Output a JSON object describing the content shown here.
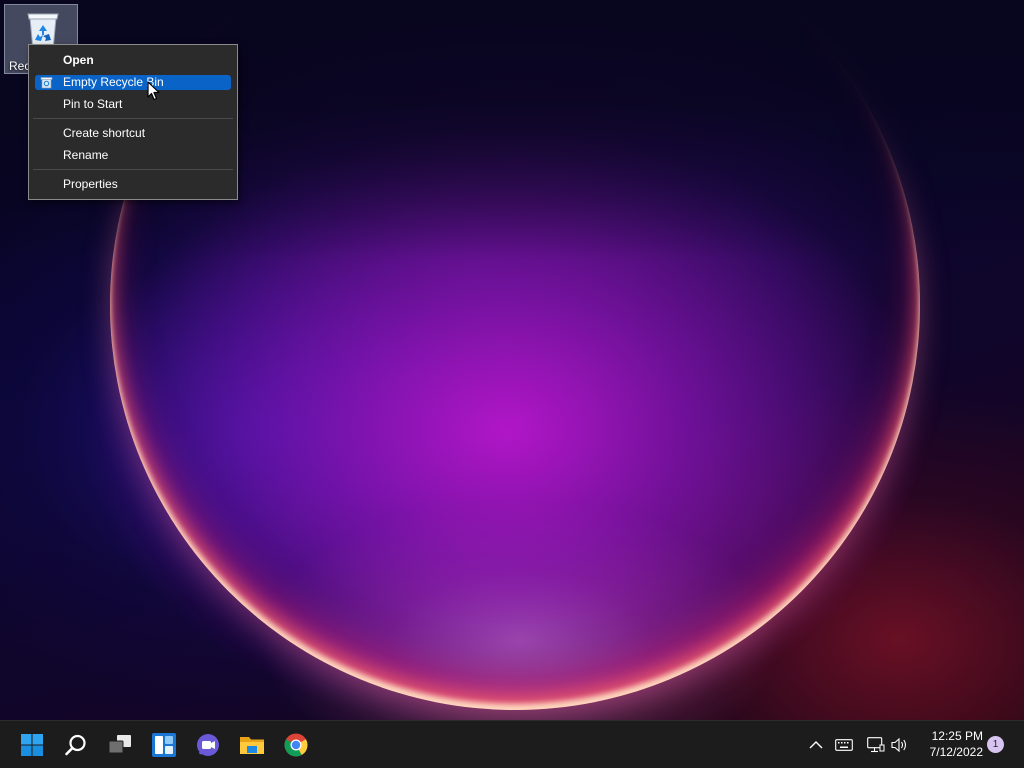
{
  "desktop": {
    "icons": [
      {
        "label": "Rec",
        "icon": "recycle-bin-icon"
      }
    ]
  },
  "context_menu": {
    "items": [
      {
        "label": "Open",
        "bold": true
      },
      {
        "label": "Empty Recycle Bin",
        "highlighted": true,
        "icon": "recycle-bin-small-icon"
      },
      {
        "label": "Pin to Start"
      },
      {
        "label": "Create shortcut"
      },
      {
        "label": "Rename"
      },
      {
        "label": "Properties"
      }
    ],
    "highlight_color": "#0a64c8"
  },
  "taskbar": {
    "apps": [
      {
        "name": "start",
        "icon": "windows-logo-icon"
      },
      {
        "name": "search",
        "icon": "search-icon"
      },
      {
        "name": "task-view",
        "icon": "task-view-icon"
      },
      {
        "name": "widgets",
        "icon": "widgets-icon"
      },
      {
        "name": "teams-chat",
        "icon": "chat-icon"
      },
      {
        "name": "file-explorer",
        "icon": "folder-icon"
      },
      {
        "name": "chrome",
        "icon": "chrome-icon"
      }
    ],
    "tray": {
      "icons": [
        "chevron-up-icon",
        "keyboard-icon",
        "network-icon",
        "volume-icon"
      ],
      "time": "12:25 PM",
      "date": "7/12/2022",
      "notification_count": "1"
    }
  }
}
